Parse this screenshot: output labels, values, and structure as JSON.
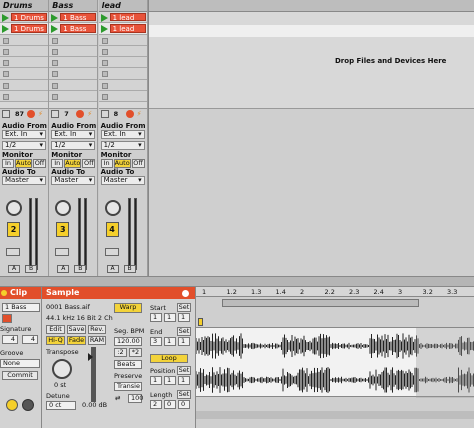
{
  "tracks": [
    {
      "name": "Drums",
      "clip": "1 Drums",
      "clip_playing": true,
      "send": "87",
      "number": "2"
    },
    {
      "name": "Bass",
      "clip": "1 Bass",
      "clip_playing": true,
      "send": "7",
      "number": "3"
    },
    {
      "name": "lead",
      "clip": "1 lead",
      "clip_playing": true,
      "send": "8",
      "number": "4"
    }
  ],
  "drop_text": "Drop Files and Devices Here",
  "mixer": {
    "audio_from": "Audio From",
    "ext_in": "Ext. In",
    "channel": "1/2",
    "monitor": "Monitor",
    "in": "In",
    "auto": "Auto",
    "off": "Off",
    "audio_to": "Audio To",
    "master": "Master",
    "a": "A",
    "b": "B"
  },
  "clip_panel": {
    "title": "Clip",
    "name": "1 Bass",
    "signature_label": "Signature",
    "sig_num": "4",
    "sig_den": "4",
    "groove_label": "Groove",
    "groove_value": "None",
    "commit": "Commit"
  },
  "sample_panel": {
    "title": "Sample",
    "file": "0001 Bass.aif",
    "info": "44.1 kHz 16 Bit 2 Ch",
    "edit": "Edit",
    "save": "Save",
    "rev": "Rev.",
    "hiq": "Hi-Q",
    "fade": "Fade",
    "ram": "RAM",
    "transpose_label": "Transpose",
    "transpose_value": "0 st",
    "detune_label": "Detune",
    "detune_value": "0 ct",
    "volume": "0.00 dB",
    "warp": "Warp",
    "seg_bpm_label": "Seg. BPM",
    "seg_bpm": "120.00",
    "half": ":2",
    "double": "*2",
    "beats": "Beats",
    "preserve_label": "Preserve",
    "transients": "Transie",
    "value_100": "100"
  },
  "loop_panel": {
    "start": "Start",
    "end": "End",
    "loop": "Loop",
    "position": "Position",
    "length": "Length",
    "set": "Set",
    "start_v": [
      "1",
      "1",
      "1"
    ],
    "end_v": [
      "3",
      "1",
      "1"
    ],
    "pos_v": [
      "1",
      "1",
      "1"
    ],
    "len_v": [
      "2",
      "0",
      "0"
    ]
  },
  "ruler": [
    "1",
    "1.2",
    "1.3",
    "1.4",
    "2",
    "2.2",
    "2.3",
    "2.4",
    "3",
    "3.2",
    "3.3"
  ]
}
